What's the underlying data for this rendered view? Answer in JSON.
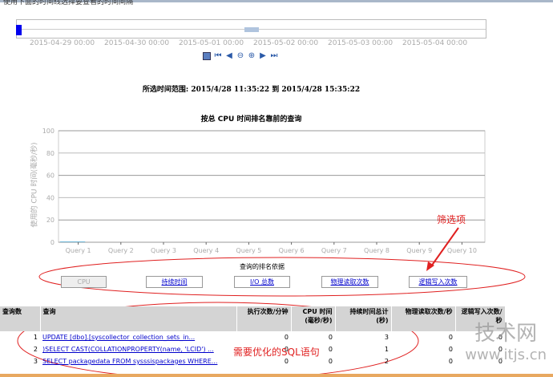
{
  "header": {
    "text": "使用下面的时间线选择要查看的时间间隔"
  },
  "timeline": {
    "dates": [
      "2015-04-29 00:00",
      "2015-04-30 00:00",
      "2015-05-01 00:00",
      "2015-05-02 00:00",
      "2015-05-03 00:00",
      "2015-05-04 00:00"
    ],
    "nav_icons": [
      "calendar-icon",
      "first-icon",
      "previous-icon",
      "zoom-out-icon",
      "zoom-in-icon",
      "next-icon",
      "last-icon"
    ]
  },
  "range_text": "所选时间范围: 2015/4/28 11:35:22 到 2015/4/28 15:35:22",
  "chart_data": {
    "type": "bar",
    "title": "按总 CPU 时间排名靠前的查询",
    "ylabel": "使用的 CPU 时间(毫秒/秒)",
    "xlabel": "",
    "categories": [
      "Query 1",
      "Query 2",
      "Query 3",
      "Query 4",
      "Query 5",
      "Query 6",
      "Query 7",
      "Query 8",
      "Query 9",
      "Query 10"
    ],
    "values": [
      0,
      0,
      0,
      0,
      0,
      0,
      0,
      0,
      0,
      0
    ],
    "ylim": [
      0,
      100
    ],
    "yticks": [
      0,
      20,
      40,
      60,
      80,
      100
    ],
    "grid": true,
    "bar_color": "#6fb7d8"
  },
  "ranking": {
    "label": "查询的排名依据",
    "buttons": [
      "CPU",
      "持续时间",
      "I/O 总数",
      "物理读取次数",
      "逻辑写入次数"
    ],
    "selected": 0
  },
  "table": {
    "headers": [
      "查询数",
      "查询",
      "执行次数/分钟",
      "CPU 时间 (毫秒/秒)",
      "持续时间总计 (秒)",
      "物理读取次数/秒",
      "逻辑写入次数/秒"
    ],
    "rows": [
      [
        "1",
        "UPDATE [dbo].[syscollector_collection_sets_in...",
        "0",
        "0",
        "3",
        "0",
        "0"
      ],
      [
        "2",
        ")SELECT CAST(COLLATIONPROPERTY(name, 'LCID') ...",
        "0",
        "0",
        "1",
        "0",
        "0"
      ],
      [
        "3",
        "SELECT packagedata FROM sysssispackages WHERE...",
        "0",
        "0",
        "2",
        "0",
        "0"
      ]
    ]
  },
  "annotations": {
    "filter": "筛选项",
    "sql": "需要优化的SQL语句",
    "color": "#e02020"
  },
  "watermark": {
    "logo": "技术网",
    "url": "www.itjs.cn"
  }
}
